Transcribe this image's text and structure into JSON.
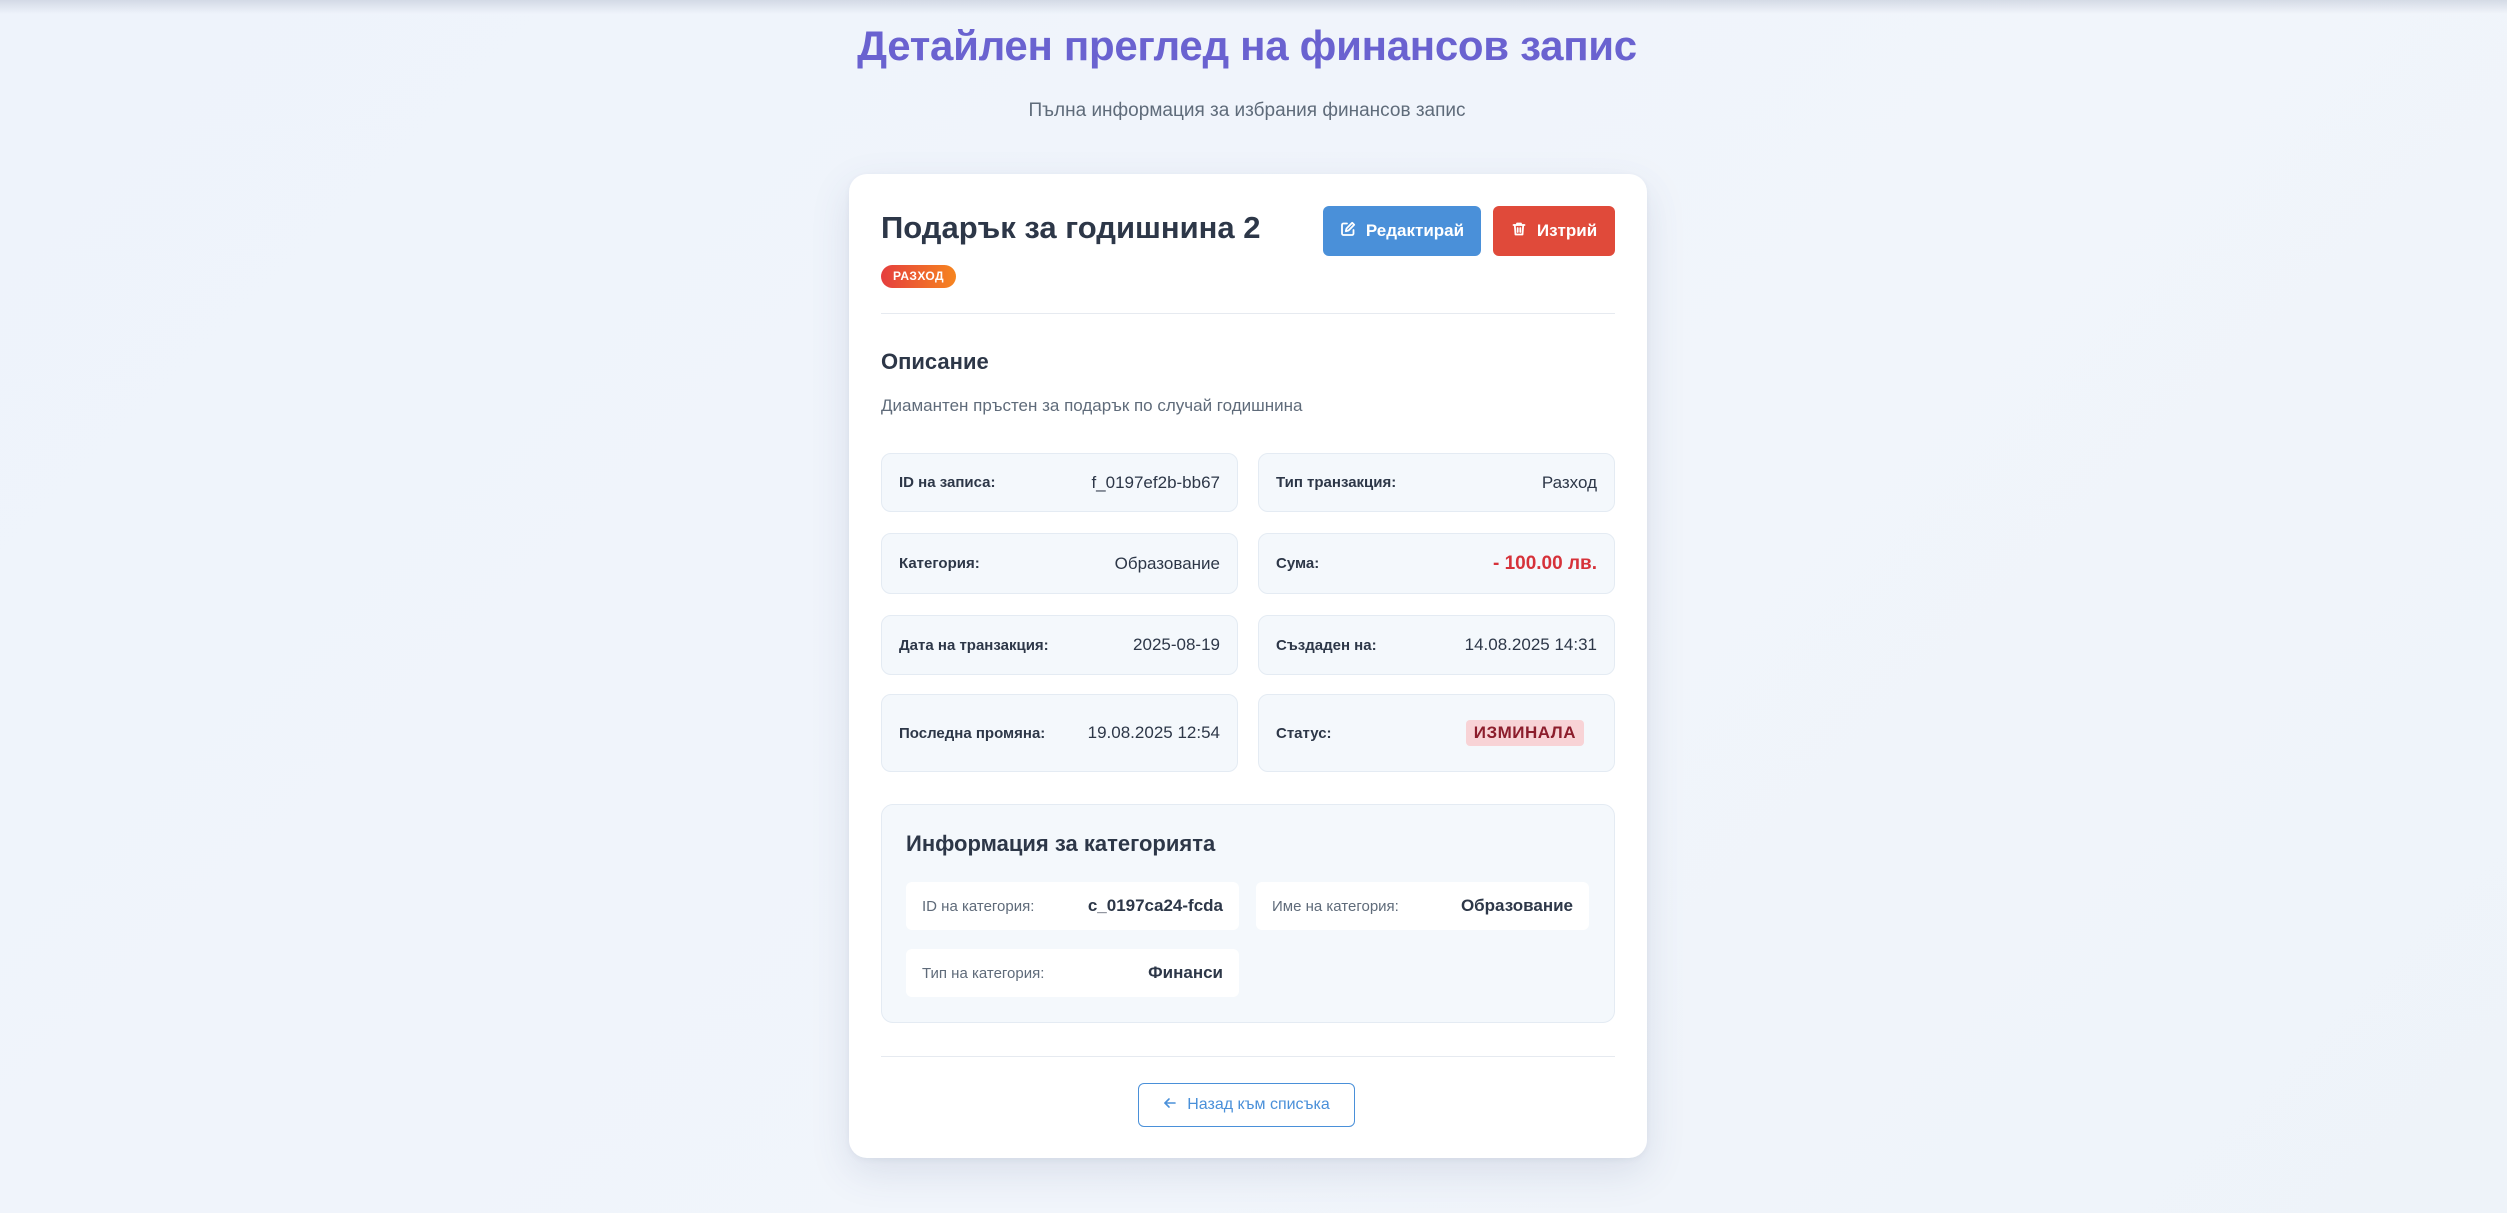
{
  "page": {
    "title": "Детайлен преглед на финансов запис",
    "subtitle": "Пълна информация за избрания финансов запис"
  },
  "record": {
    "title": "Подарък за годишнина 2",
    "type_badge": "РАЗХОД",
    "actions": {
      "edit_label": "Редактирай",
      "delete_label": "Изтрий"
    },
    "description_heading": "Описание",
    "description": "Диамантен пръстен за подарък по случай годишнина",
    "fields": {
      "id": {
        "label": "ID на записа:",
        "value": "f_0197ef2b-bb67"
      },
      "type": {
        "label": "Тип транзакция:",
        "value": "Разход"
      },
      "category": {
        "label": "Категория:",
        "value": "Образование"
      },
      "amount": {
        "label": "Сума:",
        "value": "- 100.00 лв."
      },
      "date": {
        "label": "Дата на транзакция:",
        "value": "2025-08-19"
      },
      "created": {
        "label": "Създаден на:",
        "value": "14.08.2025 14:31"
      },
      "modified": {
        "label": "Последна промяна:",
        "value": "19.08.2025 12:54"
      },
      "status": {
        "label": "Статус:",
        "value": "ИЗМИНАЛА"
      }
    }
  },
  "category_info": {
    "heading": "Информация за категорията",
    "id": {
      "label": "ID на категория:",
      "value": "c_0197ca24-fcda"
    },
    "name": {
      "label": "Име на категория:",
      "value": "Образование"
    },
    "type": {
      "label": "Тип на категория:",
      "value": "Финанси"
    }
  },
  "back_button": {
    "label": "Назад към списъка"
  },
  "colors": {
    "title": "#6a62d0",
    "edit": "#4a90d9",
    "delete": "#e04a3a",
    "amount": "#d6323a",
    "status_bg": "#f8d3d6",
    "status_text": "#8c1d2c"
  },
  "icons": {
    "edit": "edit-icon",
    "delete": "trash-icon",
    "back": "arrow-left-icon"
  }
}
